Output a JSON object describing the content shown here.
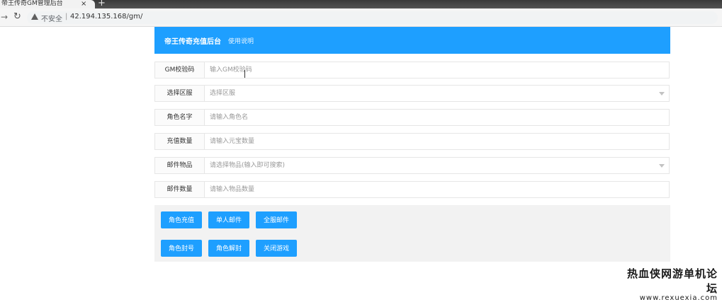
{
  "browser": {
    "tab_title": "帝王传奇GM管理后台",
    "tab_close": "×",
    "new_tab": "+",
    "security_label": "不安全",
    "url": "42.194.135.168/gm/"
  },
  "header": {
    "brand": "帝王传奇充值后台",
    "help_link": "使用说明"
  },
  "form": {
    "gm_code": {
      "label": "GM校验码",
      "placeholder": "输入GM校验码"
    },
    "server": {
      "label": "选择区服",
      "placeholder": "选择区服"
    },
    "role_name": {
      "label": "角色名字",
      "placeholder": "请输入角色名"
    },
    "recharge_amount": {
      "label": "充值数量",
      "placeholder": "请输入元宝数量"
    },
    "mail_item": {
      "label": "邮件物品",
      "placeholder": "请选择物品(输入即可搜索)"
    },
    "mail_quantity": {
      "label": "邮件数量",
      "placeholder": "请输入物品数量"
    }
  },
  "buttons": {
    "recharge": "角色充值",
    "single_mail": "单人邮件",
    "all_mail": "全服邮件",
    "ban": "角色封号",
    "unban": "角色解封",
    "close_game": "关闭游戏"
  },
  "watermark": {
    "site_name": "热血侠网游单机论坛",
    "site_url": "www.rexuexia.com"
  },
  "colors": {
    "primary": "#1e9fff",
    "panel_bg": "#f2f2f2",
    "border": "#e6e6e6"
  }
}
